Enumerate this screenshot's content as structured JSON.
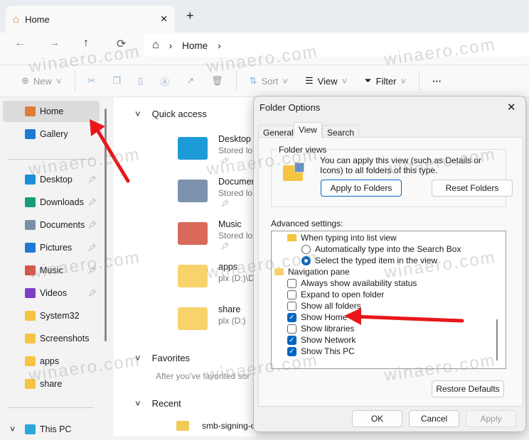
{
  "tab": {
    "title": "Home",
    "close": "✕",
    "new": "+"
  },
  "nav": {
    "back": "←",
    "forward": "→",
    "up": "↑",
    "refresh": "⟳",
    "breadcrumb": [
      "Home"
    ],
    "sep": "›"
  },
  "toolbar": {
    "new": "New",
    "sort": "Sort",
    "view": "View",
    "filter": "Filter",
    "more": "···"
  },
  "sidebar": {
    "items": [
      {
        "label": "Home",
        "color": "#e07b39"
      },
      {
        "label": "Gallery",
        "color": "#1f7ad4"
      },
      {
        "label": "Desktop",
        "color": "#1c8fd6",
        "pinned": true
      },
      {
        "label": "Downloads",
        "color": "#1a9b79",
        "pinned": true
      },
      {
        "label": "Documents",
        "color": "#7a8fa6",
        "pinned": true
      },
      {
        "label": "Pictures",
        "color": "#1f7ad4",
        "pinned": true
      },
      {
        "label": "Music",
        "color": "#d8534b",
        "pinned": true
      },
      {
        "label": "Videos",
        "color": "#7c3fc4",
        "pinned": true
      },
      {
        "label": "System32",
        "color": "#f5c542"
      },
      {
        "label": "Screenshots",
        "color": "#f5c542"
      },
      {
        "label": "apps",
        "color": "#f5c542"
      },
      {
        "label": "share",
        "color": "#f5c542"
      },
      {
        "label": "This PC",
        "color": "#2aa7d8"
      }
    ]
  },
  "content": {
    "quick_access": "Quick access",
    "items": [
      {
        "name": "Desktop",
        "sub": "Stored lo",
        "pinned": true,
        "color": "#1d9bd8"
      },
      {
        "name": "Documer",
        "sub": "Stored lo",
        "pinned": true,
        "color": "#7d93ad"
      },
      {
        "name": "Music",
        "sub": "Stored lo",
        "pinned": true,
        "color": "#d9695a"
      },
      {
        "name": "apps",
        "sub": "plx (D:)\\D",
        "pinned": false,
        "color": "#f8d36b"
      },
      {
        "name": "share",
        "sub": "plx (D:)",
        "pinned": false,
        "color": "#f8d36b"
      }
    ],
    "favorites": "Favorites",
    "favorites_empty": "After you've favorited sor",
    "recent": "Recent",
    "recent_item": "smb-signing-c"
  },
  "dialog": {
    "title": "Folder Options",
    "close": "✕",
    "tabs": [
      "General",
      "View",
      "Search"
    ],
    "folder_views": "Folder views",
    "folder_views_text": "You can apply this view (such as Details or Icons) to all folders of this type.",
    "apply_to_folders": "Apply to Folders",
    "reset_folders": "Reset Folders",
    "advanced": "Advanced settings:",
    "list": [
      {
        "type": "folder",
        "label": "When typing into list view"
      },
      {
        "type": "radio",
        "label": "Automatically type into the Search Box",
        "checked": false
      },
      {
        "type": "radio",
        "label": "Select the typed item in the view",
        "checked": true
      },
      {
        "type": "group",
        "label": "Navigation pane"
      },
      {
        "type": "check",
        "label": "Always show availability status",
        "checked": false
      },
      {
        "type": "check",
        "label": "Expand to open folder",
        "checked": false
      },
      {
        "type": "check",
        "label": "Show all folders",
        "checked": false
      },
      {
        "type": "check",
        "label": "Show Home",
        "checked": true
      },
      {
        "type": "check",
        "label": "Show libraries",
        "checked": false
      },
      {
        "type": "check",
        "label": "Show Network",
        "checked": true
      },
      {
        "type": "check",
        "label": "Show This PC",
        "checked": true
      }
    ],
    "restore": "Restore Defaults",
    "ok": "OK",
    "cancel": "Cancel",
    "apply": "Apply"
  },
  "watermark": "winaero.com",
  "accent": "#0067c0",
  "arrow_color": "#e8171a"
}
